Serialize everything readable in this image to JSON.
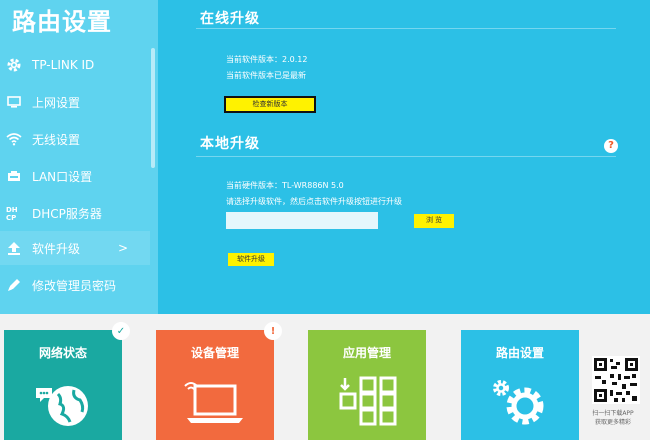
{
  "sidebar": {
    "title": "路由设置",
    "items": [
      {
        "label": "TP-LINK ID",
        "icon": "gear-icon"
      },
      {
        "label": "上网设置",
        "icon": "monitor-icon"
      },
      {
        "label": "无线设置",
        "icon": "wifi-icon"
      },
      {
        "label": "LAN口设置",
        "icon": "lan-port-icon"
      },
      {
        "label": "DHCP服务器",
        "icon": "dhcp-icon"
      },
      {
        "label": "软件升级",
        "icon": "upload-icon",
        "arrow": ">"
      },
      {
        "label": "修改管理员密码",
        "icon": "pencil-icon"
      }
    ]
  },
  "online_upgrade": {
    "title": "在线升级",
    "current_version": "当前软件版本：2.0.12",
    "status": "当前软件版本已是最新",
    "check_button": "检查新版本"
  },
  "local_upgrade": {
    "title": "本地升级",
    "hardware_version": "当前硬件版本：TL-WR886N 5.0",
    "instruction": "请选择升级软件，然后点击软件升级按钮进行升级",
    "file_value": "",
    "browse_button": "浏 览",
    "upgrade_button": "软件升级",
    "help": "?"
  },
  "bottom": {
    "tiles": [
      {
        "label": "网络状态",
        "color": "#1aa9a1",
        "badge": "✓"
      },
      {
        "label": "设备管理",
        "color": "#f26a3e",
        "badge": "!"
      },
      {
        "label": "应用管理",
        "color": "#8cc63f"
      },
      {
        "label": "路由设置",
        "color": "#2cc0e6"
      }
    ],
    "qr_text_1": "扫一扫下载APP",
    "qr_text_2": "获取更多精彩"
  }
}
